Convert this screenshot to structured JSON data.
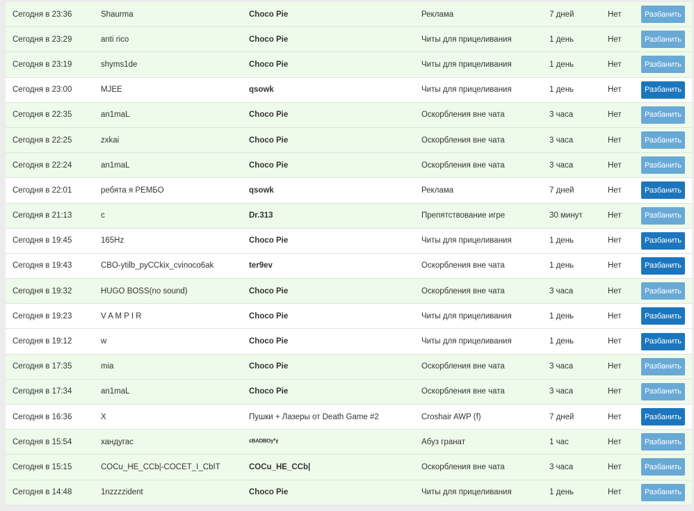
{
  "unban_label": "Разбанить",
  "colors": {
    "expired_row_bg": "#eefbea",
    "active_row_bg": "#ffffff",
    "button_enabled": "#1c76bd",
    "button_disabled": "#69a9d6"
  },
  "bans": [
    {
      "date": "Сегодня в 23:36",
      "player": "Shaurma",
      "admin": "Choco Pie",
      "reason": "Реклама",
      "duration": "7 дней",
      "status": "Нет",
      "active": false
    },
    {
      "date": "Сегодня в 23:29",
      "player": "anti rico",
      "admin": "Choco Pie",
      "reason": "Читы для прицеливания",
      "duration": "1 день",
      "status": "Нет",
      "active": false
    },
    {
      "date": "Сегодня в 23:19",
      "player": "shyms1de",
      "admin": "Choco Pie",
      "reason": "Читы для прицеливания",
      "duration": "1 день",
      "status": "Нет",
      "active": false
    },
    {
      "date": "Сегодня в 23:00",
      "player": "MJEE",
      "admin": "qsowk",
      "reason": "Читы для прицеливания",
      "duration": "1 день",
      "status": "Нет",
      "active": true
    },
    {
      "date": "Сегодня в 22:35",
      "player": "an1maL",
      "admin": "Choco Pie",
      "reason": "Оскорбления вне чата",
      "duration": "3 часа",
      "status": "Нет",
      "active": false
    },
    {
      "date": "Сегодня в 22:25",
      "player": "zxkai",
      "admin": "Choco Pie",
      "reason": "Оскорбления вне чата",
      "duration": "3 часа",
      "status": "Нет",
      "active": false
    },
    {
      "date": "Сегодня в 22:24",
      "player": "an1maL",
      "admin": "Choco Pie",
      "reason": "Оскорбления вне чата",
      "duration": "3 часа",
      "status": "Нет",
      "active": false
    },
    {
      "date": "Сегодня в 22:01",
      "player": "ребята я РЕМБО",
      "admin": "qsowk",
      "reason": "Реклама",
      "duration": "7 дней",
      "status": "Нет",
      "active": true
    },
    {
      "date": "Сегодня в 21:13",
      "player": "c",
      "admin": "Dr.313",
      "reason": "Препятствование игре",
      "duration": "30 минут",
      "status": "Нет",
      "active": false
    },
    {
      "date": "Сегодня в 19:45",
      "player": "165Hz",
      "admin": "Choco Pie",
      "reason": "Читы для прицеливания",
      "duration": "1 день",
      "status": "Нет",
      "active": true
    },
    {
      "date": "Сегодня в 19:43",
      "player": "CBO-ytilb_pyCCkix_cvinoco6ak",
      "admin": "ter9ev",
      "reason": "Оскорбления вне чата",
      "duration": "1 день",
      "status": "Нет",
      "active": true
    },
    {
      "date": "Сегодня в 19:32",
      "player": "HUGO BOSS(no sound)",
      "admin": "Choco Pie",
      "reason": "Оскорбления вне чата",
      "duration": "3 часа",
      "status": "Нет",
      "active": false
    },
    {
      "date": "Сегодня в 19:23",
      "player": "V A M P I R",
      "admin": "Choco Pie",
      "reason": "Читы для прицеливания",
      "duration": "1 день",
      "status": "Нет",
      "active": true
    },
    {
      "date": "Сегодня в 19:12",
      "player": "w",
      "admin": "Choco Pie",
      "reason": "Читы для прицеливания",
      "duration": "1 день",
      "status": "Нет",
      "active": true
    },
    {
      "date": "Сегодня в 17:35",
      "player": "mia",
      "admin": "Choco Pie",
      "reason": "Оскорбления вне чата",
      "duration": "3 часа",
      "status": "Нет",
      "active": false
    },
    {
      "date": "Сегодня в 17:34",
      "player": "an1maL",
      "admin": "Choco Pie",
      "reason": "Оскорбления вне чата",
      "duration": "3 часа",
      "status": "Нет",
      "active": false
    },
    {
      "date": "Сегодня в 16:36",
      "player": "X",
      "admin": "Пушки + Лазеры от Death Game #2",
      "admin_plain": true,
      "reason": "Croshair AWP (f)",
      "duration": "7 дней",
      "status": "Нет",
      "active": true
    },
    {
      "date": "Сегодня в 15:54",
      "player": "хандугас",
      "admin": "ᵋᴮᴬᴰᴮᴼʸ'ᵞ",
      "reason": "Абуз гранат",
      "duration": "1 час",
      "status": "Нет",
      "active": false
    },
    {
      "date": "Сегодня в 15:15",
      "player": "COCu_HE_CCb|-COCET_I_CbIT",
      "admin": "COCu_HE_CCb|",
      "reason": "Оскорбления вне чата",
      "duration": "3 часа",
      "status": "Нет",
      "active": false
    },
    {
      "date": "Сегодня в 14:48",
      "player": "1nzzzzident",
      "admin": "Choco Pie",
      "reason": "Читы для прицеливания",
      "duration": "1 день",
      "status": "Нет",
      "active": false
    }
  ]
}
